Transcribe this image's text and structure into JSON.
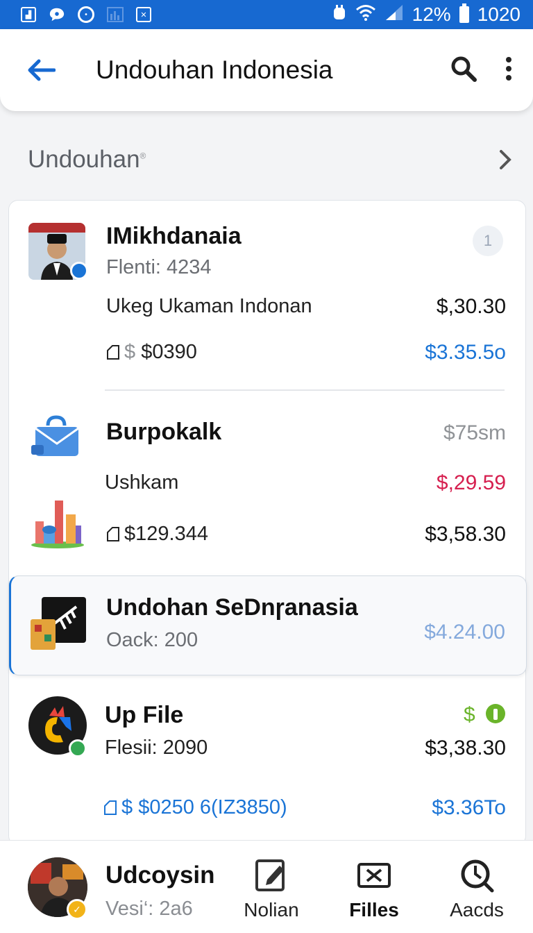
{
  "status_bar": {
    "battery_percent": "12%",
    "time": "1020"
  },
  "app_bar": {
    "title": "Undouhan Indonesia"
  },
  "section": {
    "title": "Undouhan",
    "mark": "®"
  },
  "items": [
    {
      "name": "IMikhdanaia",
      "subtitle": "Flenti: 4234",
      "badge": "1",
      "description": "Ukeg Ukaman Indonan",
      "price_right_1": "$,30.30",
      "price_left": "$0390",
      "price_right_2": "$3.35.5o"
    },
    {
      "name": "Burpokalk",
      "size": "$75sm",
      "description": "Ushkam",
      "price_right_1": "$,29.59",
      "price_left": "$129.344",
      "price_right_2": "$3,58.30"
    },
    {
      "name": "Undohan SeDnɼanasia",
      "subtitle": "Oack: 200",
      "price_right_1": "$4.24.00"
    },
    {
      "name": "Up File",
      "status_mark": "$",
      "subtitle": "Flesii: 2090",
      "price_right_1": "$3,38.30",
      "price_left": "$0250 6(IZ3850)",
      "price_right_2": "$3.36To"
    }
  ],
  "bottom_bar": {
    "user_name": "Udcoysin",
    "user_version": "Vesi‘: 2a6",
    "nav": [
      {
        "label": "Nolian",
        "icon": "edit-icon"
      },
      {
        "label": "Filles",
        "icon": "files-icon"
      },
      {
        "label": "Aacds",
        "icon": "search-icon"
      }
    ]
  },
  "colors": {
    "primary": "#1769d1",
    "link_blue": "#1a74d6",
    "red": "#d61f4f",
    "green": "#6ab42a"
  }
}
